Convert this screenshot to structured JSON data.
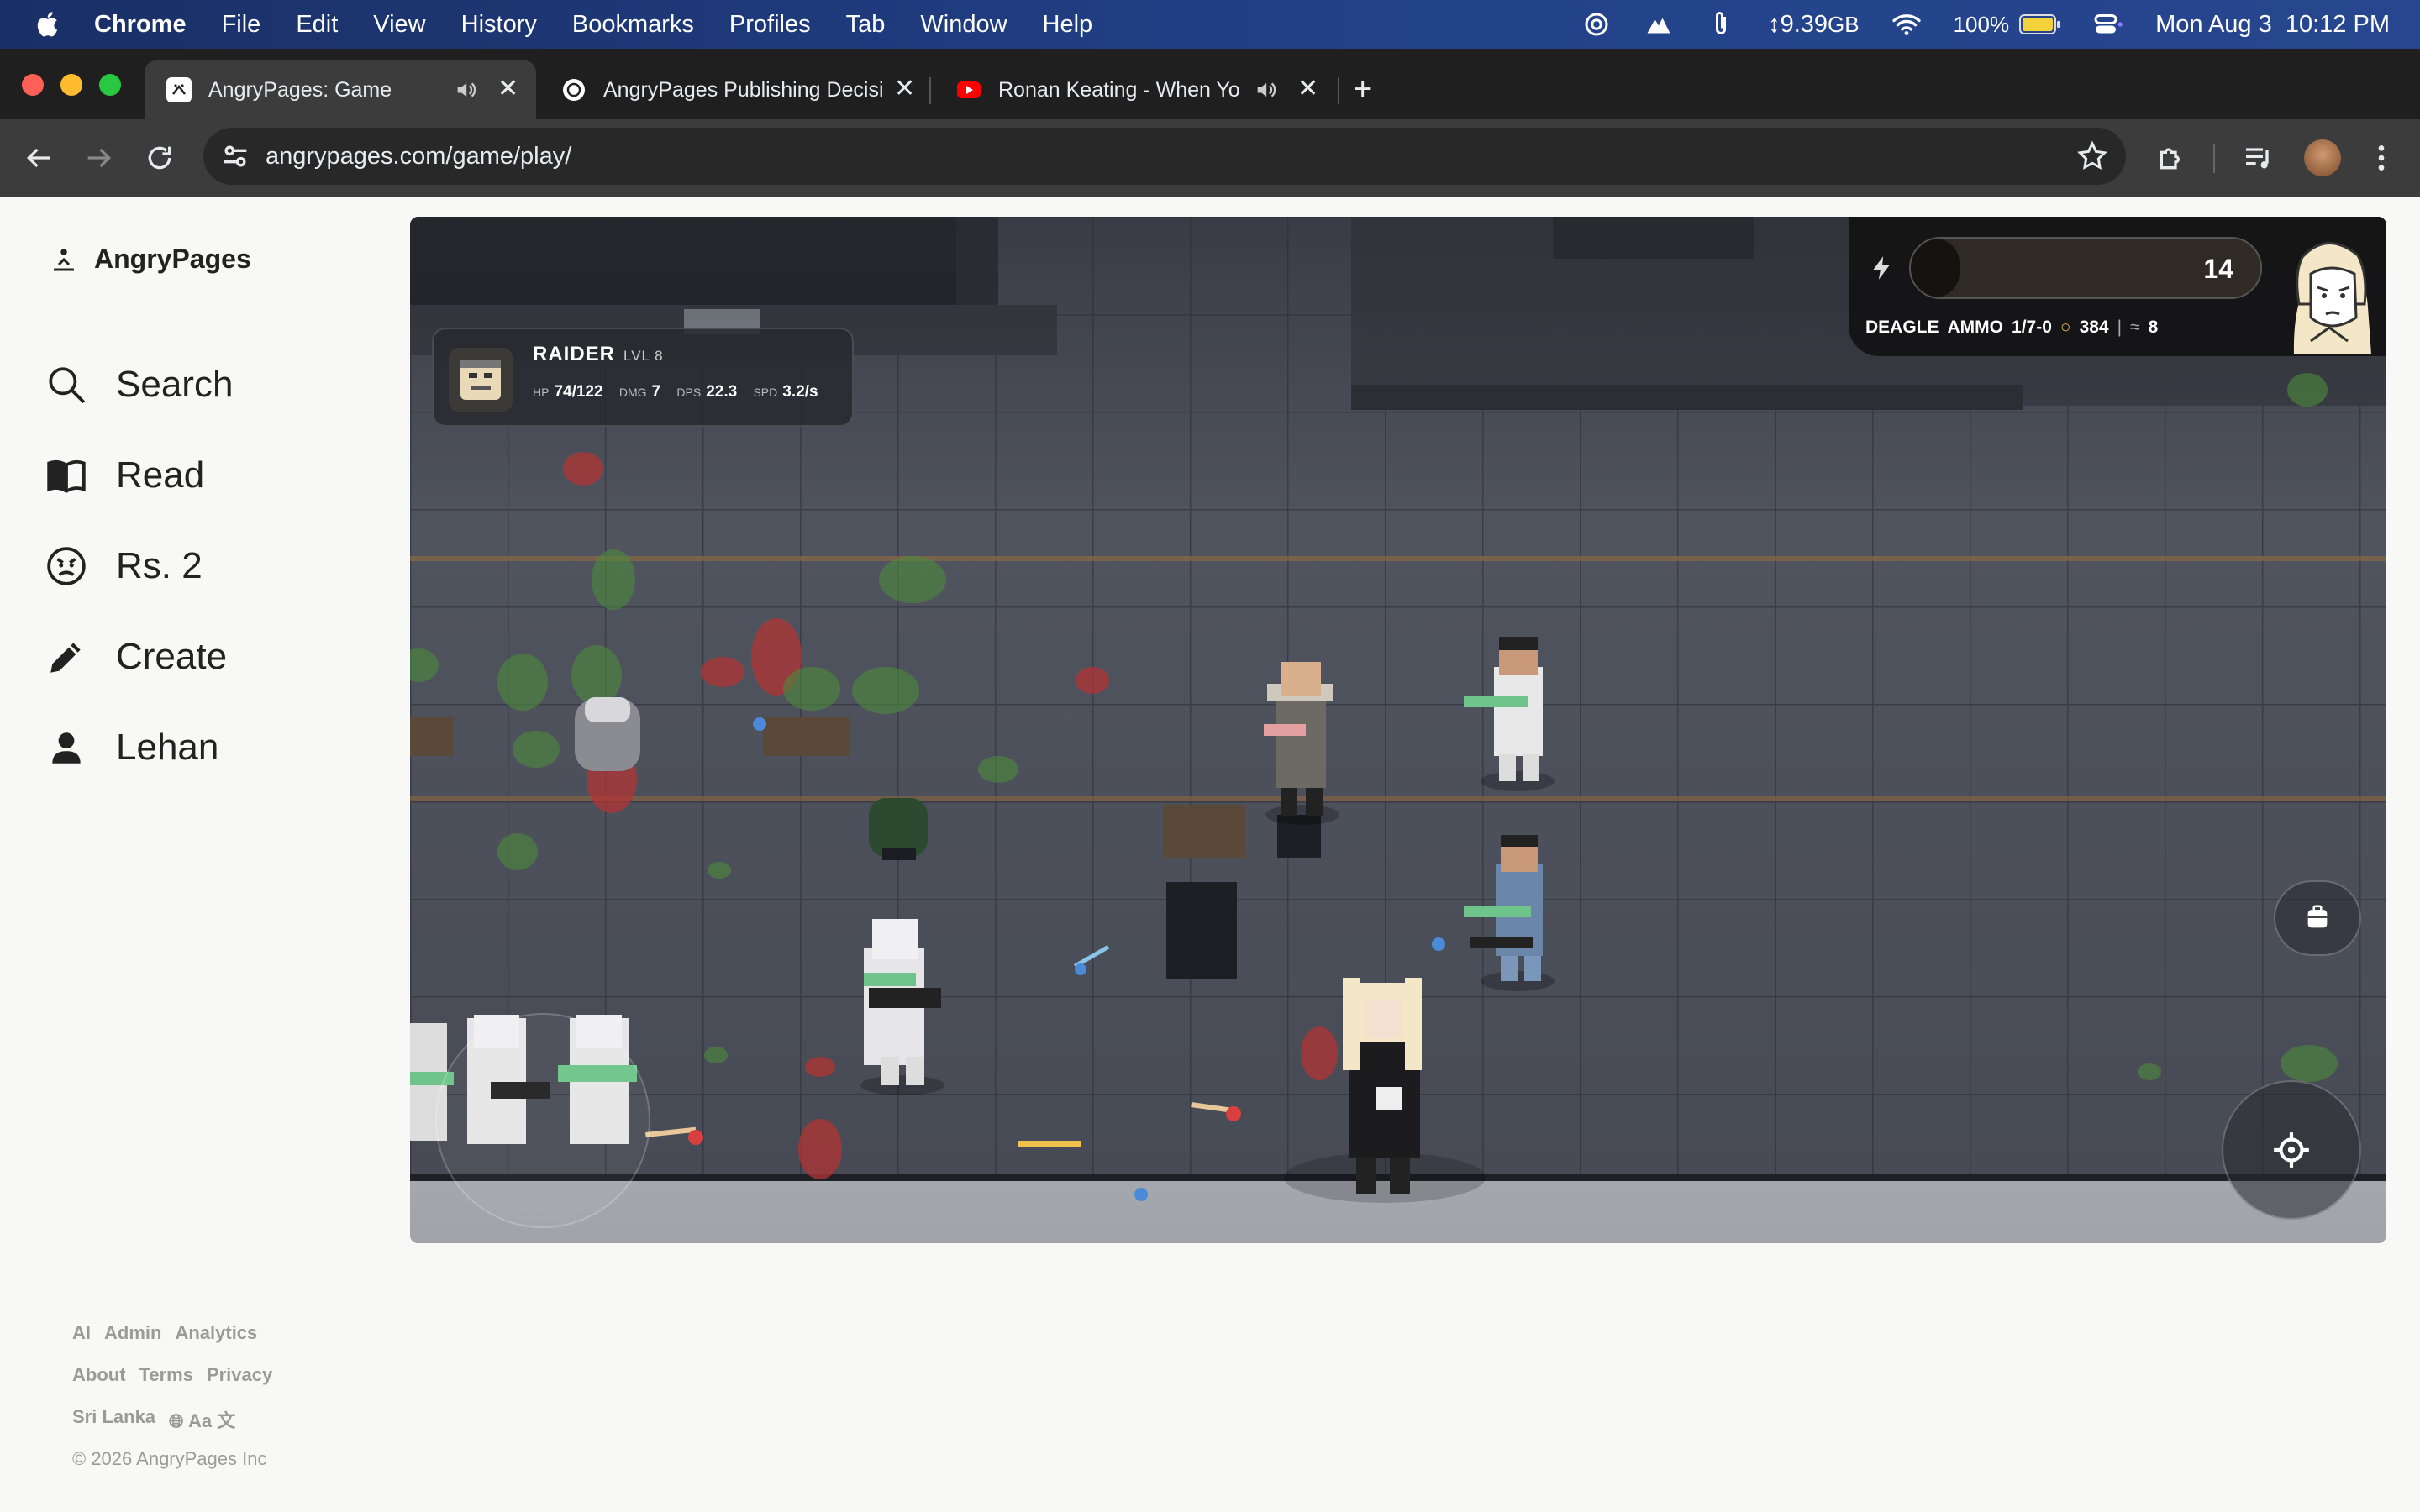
{
  "menubar": {
    "app": "Chrome",
    "items": [
      "File",
      "Edit",
      "View",
      "History",
      "Bookmarks",
      "Profiles",
      "Tab",
      "Window",
      "Help"
    ],
    "storage": "9.39",
    "storage_unit": "GB",
    "battery": "100%",
    "datetime": "Mon Aug 3  10:12 PM"
  },
  "tabs": [
    {
      "title": "AngryPages: Game",
      "active": true,
      "audio": true
    },
    {
      "title": "AngryPages Publishing Decisi",
      "active": false,
      "audio": false
    },
    {
      "title": "Ronan Keating - When Yo",
      "active": false,
      "audio": true
    }
  ],
  "toolbar": {
    "url": "angrypages.com/game/play/"
  },
  "sidebar": {
    "brand": "AngryPages",
    "items": [
      {
        "label": "Search",
        "icon": "search-icon"
      },
      {
        "label": "Read",
        "icon": "book-icon"
      },
      {
        "label": "Rs. 2",
        "icon": "angry-face-icon"
      },
      {
        "label": "Create",
        "icon": "pencil-icon"
      },
      {
        "label": "Lehan",
        "icon": "person-icon"
      }
    ],
    "footer": {
      "row1": [
        "AI",
        "Admin",
        "Analytics"
      ],
      "row2": [
        "About",
        "Terms",
        "Privacy"
      ],
      "region": "Sri Lanka",
      "lang": "Aa 文",
      "copyright": "© 2026 AngryPages Inc"
    }
  },
  "game": {
    "target": {
      "name": "RAIDER",
      "level": "LVL 8",
      "stats": [
        {
          "key": "HP",
          "value": "74/122"
        },
        {
          "key": "DMG",
          "value": "7"
        },
        {
          "key": "DPS",
          "value": "22.3"
        },
        {
          "key": "SPD",
          "value": "3.2/s"
        }
      ]
    },
    "hud": {
      "energy": "14",
      "energy_fraction": 0.14,
      "weapon": "DEAGLE",
      "ammo_label": "AMMO",
      "ammo": "1/7-0",
      "coins": "384",
      "kills": "8"
    }
  },
  "colors": {
    "menubar": "#22428a",
    "tabstrip": "#1f1f1f",
    "toolbar": "#3c3c3c",
    "page_bg": "#f8f8f6"
  }
}
